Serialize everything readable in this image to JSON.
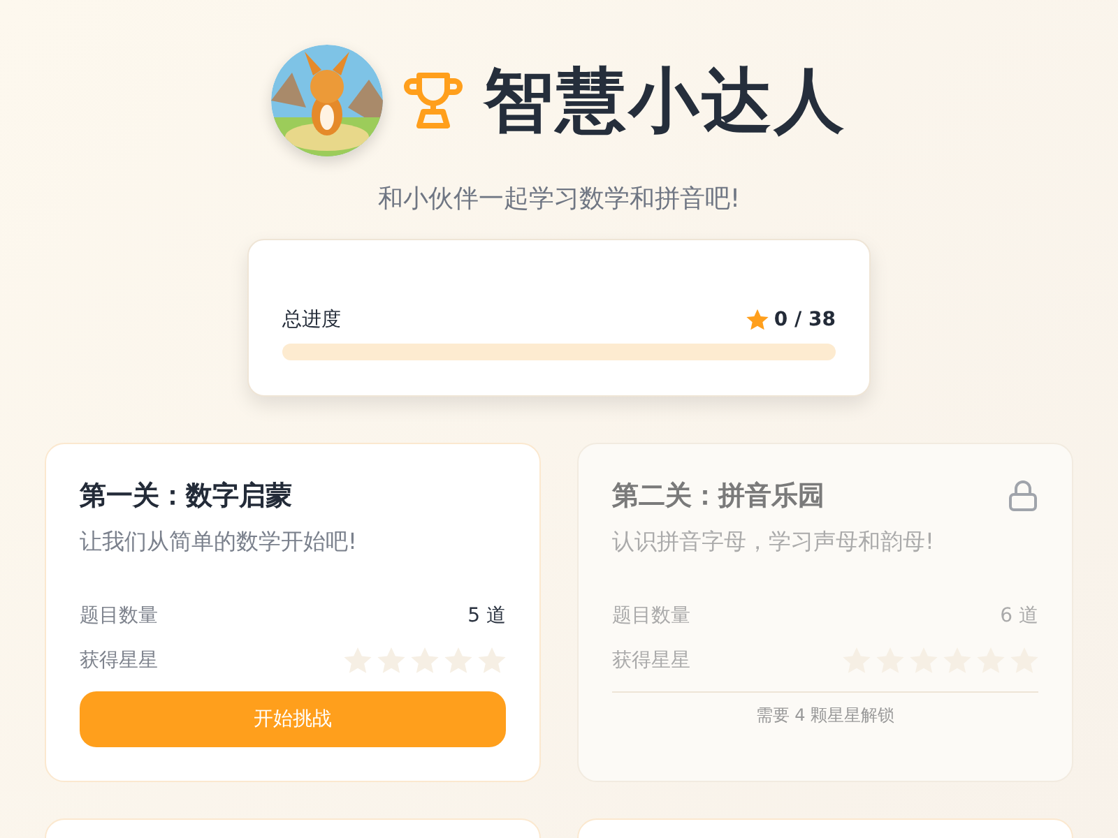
{
  "header": {
    "title": "智慧小达人",
    "subtitle": "和小伙伴一起学习数学和拼音吧!"
  },
  "progress": {
    "label": "总进度",
    "reading": "0 / 38",
    "level": 0
  },
  "levels": [
    {
      "title": "第一关：数字启蒙",
      "description": "让我们从简单的数学开始吧!",
      "locked": false,
      "count_label": "题目数量",
      "count": "5 道",
      "stars_label": "获得星星",
      "star_slots": [
        {
          "filled": false
        },
        {
          "filled": false
        },
        {
          "filled": false
        },
        {
          "filled": false
        },
        {
          "filled": false
        }
      ],
      "action": "开始挑战"
    },
    {
      "title": "第二关：拼音乐园",
      "description": "认识拼音字母，学习声母和韵母!",
      "locked": true,
      "count_label": "题目数量",
      "count": "6 道",
      "stars_label": "获得星星",
      "star_slots": [
        {
          "filled": false
        },
        {
          "filled": false
        },
        {
          "filled": false
        },
        {
          "filled": false
        },
        {
          "filled": false
        },
        {
          "filled": false
        }
      ],
      "unlock_note": "需要 4 颗星星解锁"
    }
  ]
}
